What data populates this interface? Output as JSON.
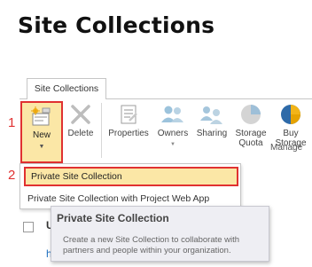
{
  "page": {
    "title": "Site Collections"
  },
  "ribbon": {
    "tab_label": "Site Collections",
    "buttons": {
      "new": "New",
      "delete": "Delete",
      "properties": "Properties",
      "owners": "Owners",
      "sharing": "Sharing",
      "storage_quota_line1": "Storage",
      "storage_quota_line2": "Quota",
      "buy_storage_line1": "Buy",
      "buy_storage_line2": "Storage"
    },
    "group_label": "Manage",
    "icons": [
      "new-site-icon",
      "delete-icon",
      "properties-icon",
      "owners-icon",
      "sharing-icon",
      "storage-quota-icon",
      "buy-storage-icon"
    ]
  },
  "markers": {
    "step1": "1",
    "step2": "2"
  },
  "new_menu": {
    "items": [
      "Private Site Collection",
      "Private Site Collection with Project Web App"
    ]
  },
  "tooltip": {
    "title": "Private Site Collection",
    "description": "Create a new Site Collection to collaborate with partners and people within your organization."
  },
  "list": {
    "partial_col": "U",
    "partial_row": "h"
  },
  "colors": {
    "highlight": "#fbe7a6",
    "annotation_red": "#e03131",
    "link_blue": "#1e6fbf"
  }
}
